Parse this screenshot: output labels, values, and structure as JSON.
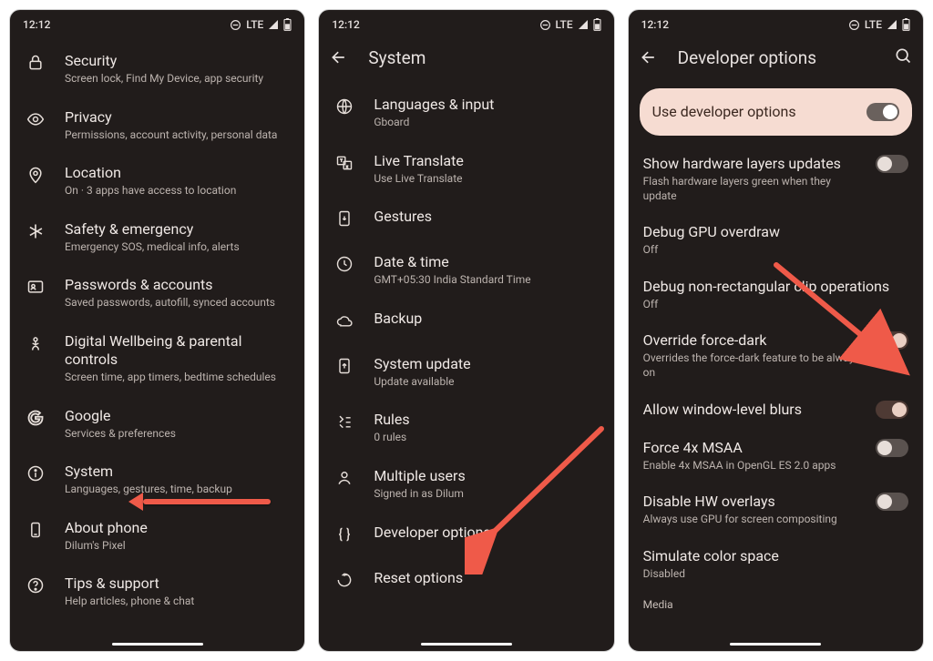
{
  "status": {
    "time": "12:12",
    "net": "LTE"
  },
  "screens": [
    {
      "header": null,
      "items": [
        {
          "icon": "lock",
          "title": "Security",
          "sub": "Screen lock, Find My Device, app security"
        },
        {
          "icon": "eye",
          "title": "Privacy",
          "sub": "Permissions, account activity, personal data"
        },
        {
          "icon": "pin",
          "title": "Location",
          "sub": "On · 3 apps have access to location"
        },
        {
          "icon": "asterisk",
          "title": "Safety & emergency",
          "sub": "Emergency SOS, medical info, alerts"
        },
        {
          "icon": "id",
          "title": "Passwords & accounts",
          "sub": "Saved passwords, autofill, synced accounts"
        },
        {
          "icon": "wellbeing",
          "title": "Digital Wellbeing & parental controls",
          "sub": "Screen time, app timers, bedtime schedules"
        },
        {
          "icon": "google",
          "title": "Google",
          "sub": "Services & preferences"
        },
        {
          "icon": "info",
          "title": "System",
          "sub": "Languages, gestures, time, backup"
        },
        {
          "icon": "phone",
          "title": "About phone",
          "sub": "Dilum's Pixel"
        },
        {
          "icon": "help",
          "title": "Tips & support",
          "sub": "Help articles, phone & chat"
        }
      ]
    },
    {
      "header": "System",
      "items": [
        {
          "icon": "globe",
          "title": "Languages & input",
          "sub": "Gboard"
        },
        {
          "icon": "translate",
          "title": "Live Translate",
          "sub": "Use Live Translate"
        },
        {
          "icon": "gesture",
          "title": "Gestures",
          "sub": ""
        },
        {
          "icon": "clock",
          "title": "Date & time",
          "sub": "GMT+05:30 India Standard Time"
        },
        {
          "icon": "cloud",
          "title": "Backup",
          "sub": ""
        },
        {
          "icon": "update",
          "title": "System update",
          "sub": "Update available"
        },
        {
          "icon": "rules",
          "title": "Rules",
          "sub": "0 rules"
        },
        {
          "icon": "user",
          "title": "Multiple users",
          "sub": "Signed in as Dilum"
        },
        {
          "icon": "braces",
          "title": "Developer options",
          "sub": ""
        },
        {
          "icon": "reset",
          "title": "Reset options",
          "sub": ""
        }
      ]
    },
    {
      "header": "Developer options",
      "search": true,
      "pill": {
        "title": "Use developer options",
        "on": true
      },
      "items": [
        {
          "title": "Show hardware layers updates",
          "sub": "Flash hardware layers green when they update",
          "toggle": true,
          "on": false
        },
        {
          "title": "Debug GPU overdraw",
          "sub": "Off"
        },
        {
          "title": "Debug non-rectangular clip operations",
          "sub": "Off"
        },
        {
          "title": "Override force-dark",
          "sub": "Overrides the force-dark feature to be always-on",
          "toggle": true,
          "on": true,
          "peach": true
        },
        {
          "title": "Allow window-level blurs",
          "sub": "",
          "toggle": true,
          "on": true,
          "peach": true
        },
        {
          "title": "Force 4x MSAA",
          "sub": "Enable 4x MSAA in OpenGL ES 2.0 apps",
          "toggle": true,
          "on": false
        },
        {
          "title": "Disable HW overlays",
          "sub": "Always use GPU for screen compositing",
          "toggle": true,
          "on": false
        },
        {
          "title": "Simulate color space",
          "sub": "Disabled"
        }
      ],
      "section": "Media"
    }
  ]
}
